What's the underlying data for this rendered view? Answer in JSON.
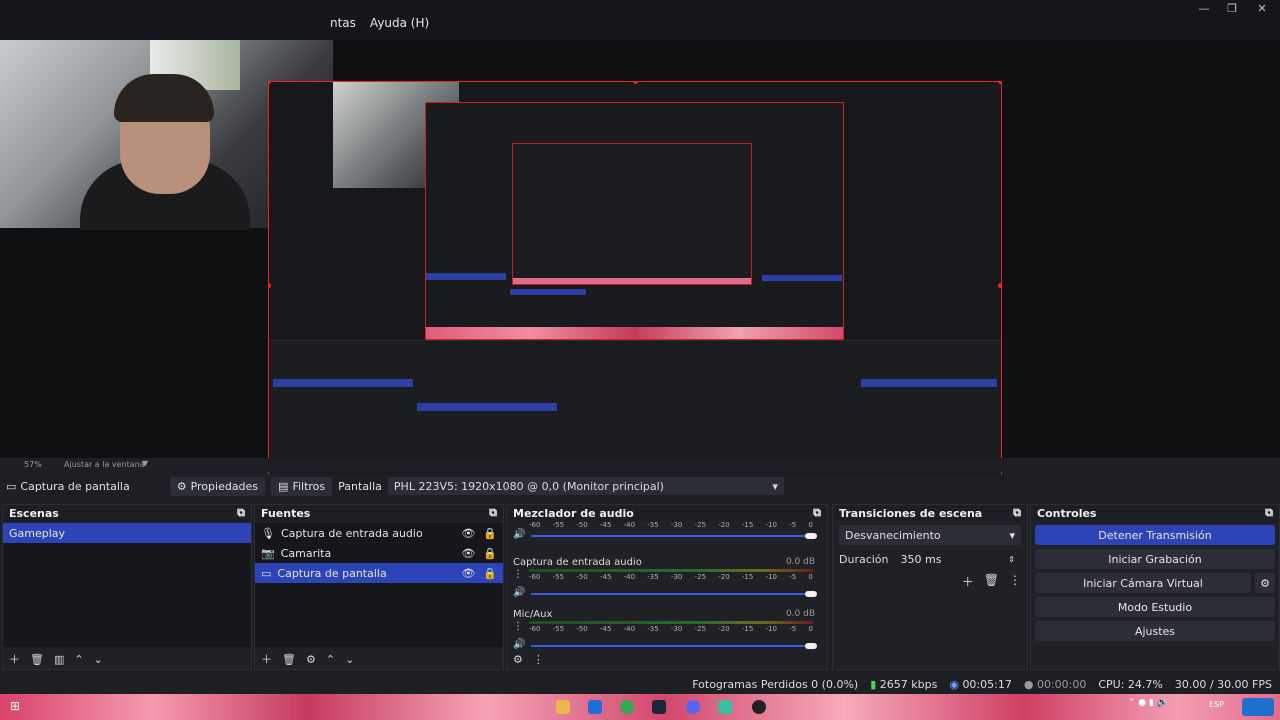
{
  "menu": {
    "items": [
      "ntas",
      "Ayuda (H)"
    ]
  },
  "window_controls": {
    "minimize": "—",
    "restore": "❐",
    "close": "✕"
  },
  "zoom": {
    "level": "57%",
    "fit_label": "Ajustar a la ventana"
  },
  "toolbar": {
    "source_name": "Captura de pantalla",
    "properties_label": "Propiedades",
    "filters_label": "Filtros",
    "display_label": "Pantalla",
    "display_value": "PHL 223V5: 1920x1080 @ 0,0 (Monitor principal)"
  },
  "scenes": {
    "title": "Escenas",
    "items": [
      {
        "label": "Gameplay",
        "selected": true
      }
    ]
  },
  "sources": {
    "title": "Fuentes",
    "items": [
      {
        "label": "Captura de entrada audio",
        "icon": "microphone-icon",
        "selected": false
      },
      {
        "label": "Camarita",
        "icon": "camera-icon",
        "selected": false
      },
      {
        "label": "Captura de pantalla",
        "icon": "monitor-icon",
        "selected": true
      }
    ]
  },
  "mixer": {
    "title": "Mezclador de audio",
    "ticks": [
      "-60",
      "-55",
      "-50",
      "-45",
      "-40",
      "-35",
      "-30",
      "-25",
      "-20",
      "-15",
      "-10",
      "-5",
      "0"
    ],
    "channels": [
      {
        "name": "",
        "db": ""
      },
      {
        "name": "Captura de entrada audio",
        "db": "0.0 dB"
      },
      {
        "name": "Mic/Aux",
        "db": "0.0 dB"
      }
    ]
  },
  "transitions": {
    "title": "Transiciones de escena",
    "selected": "Desvanecimiento",
    "duration_label": "Duración",
    "duration_value": "350 ms"
  },
  "controls": {
    "title": "Controles",
    "stop_stream": "Detener Transmisión",
    "start_recording": "Iniciar Grabación",
    "start_virtual_cam": "Iniciar Cámara Virtual",
    "studio_mode": "Modo Estudio",
    "settings": "Ajustes"
  },
  "status": {
    "dropped_frames": "Fotogramas Perdidos 0 (0.0%)",
    "bitrate": "2657 kbps",
    "live_time": "00:05:17",
    "rec_time": "00:00:00",
    "cpu": "CPU: 24.7%",
    "fps": "30.00 / 30.00 FPS"
  },
  "taskbar": {
    "lang": "ESP"
  },
  "colors": {
    "accent": "#2d44b8",
    "selection_border": "#ee2222",
    "background": "#1d1f24",
    "panel": "#16171b"
  }
}
